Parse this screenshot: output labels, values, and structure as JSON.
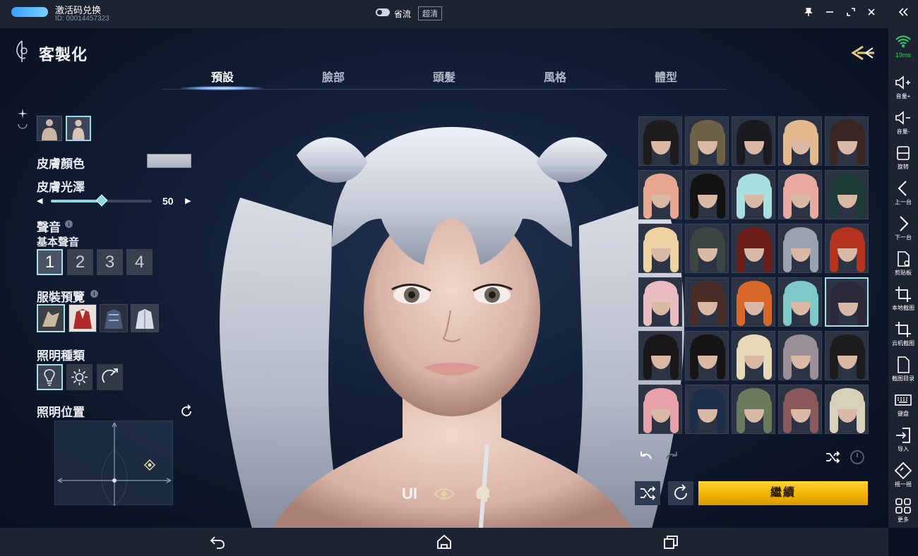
{
  "titlebar": {
    "app_title": "激活码兑换",
    "app_id": "ID: 00014457323",
    "stream_label": "省流",
    "quality_label": "超清",
    "controls": [
      "pin-icon",
      "minimize-icon",
      "expand-icon",
      "close-icon",
      "collapse-icon"
    ]
  },
  "sidebar": {
    "ping": "19ms",
    "items": [
      {
        "label": "音量+",
        "icon": "volume-up-icon"
      },
      {
        "label": "音量-",
        "icon": "volume-down-icon"
      },
      {
        "label": "旋转",
        "icon": "rotate-icon"
      },
      {
        "label": "上一台",
        "icon": "chevron-left-icon"
      },
      {
        "label": "下一台",
        "icon": "chevron-right-icon"
      },
      {
        "label": "剪贴板",
        "icon": "clipboard-icon"
      },
      {
        "label": "本地截图",
        "icon": "crop-icon"
      },
      {
        "label": "云机截图",
        "icon": "crop-icon"
      },
      {
        "label": "截图目录",
        "icon": "file-icon"
      },
      {
        "label": "键盘",
        "icon": "keyboard-icon"
      },
      {
        "label": "导入",
        "icon": "import-icon"
      },
      {
        "label": "摇一摇",
        "icon": "shake-icon"
      },
      {
        "label": "更多",
        "icon": "grid-icon"
      }
    ]
  },
  "navbar": {
    "buttons": [
      "back-icon",
      "home-icon",
      "recents-icon"
    ]
  },
  "game": {
    "title": "客製化",
    "tabs": [
      {
        "label": "預設",
        "active": true
      },
      {
        "label": "臉部",
        "active": false
      },
      {
        "label": "頭髮",
        "active": false
      },
      {
        "label": "風格",
        "active": false
      },
      {
        "label": "體型",
        "active": false
      }
    ],
    "skin_color_label": "皮膚顏色",
    "skin_color": "#bcc0cb",
    "skin_gloss_label": "皮膚光澤",
    "skin_gloss_value": "50",
    "skin_gloss_max": 100,
    "voice_label": "聲音",
    "base_voice_label": "基本聲音",
    "voices": [
      "1",
      "2",
      "3",
      "4"
    ],
    "selected_voice": "1",
    "outfit_label": "服裝預覽",
    "lighting_type_label": "照明種類",
    "lighting_position_label": "照明位置",
    "continue_label": "繼續",
    "bottom_toggle_ui": "UI",
    "hair_rows": 6,
    "hair_cols": 5,
    "selected_hair": {
      "row": 3,
      "col": 4
    },
    "accent": "#a9e0e6",
    "gold": "#f0b400"
  }
}
